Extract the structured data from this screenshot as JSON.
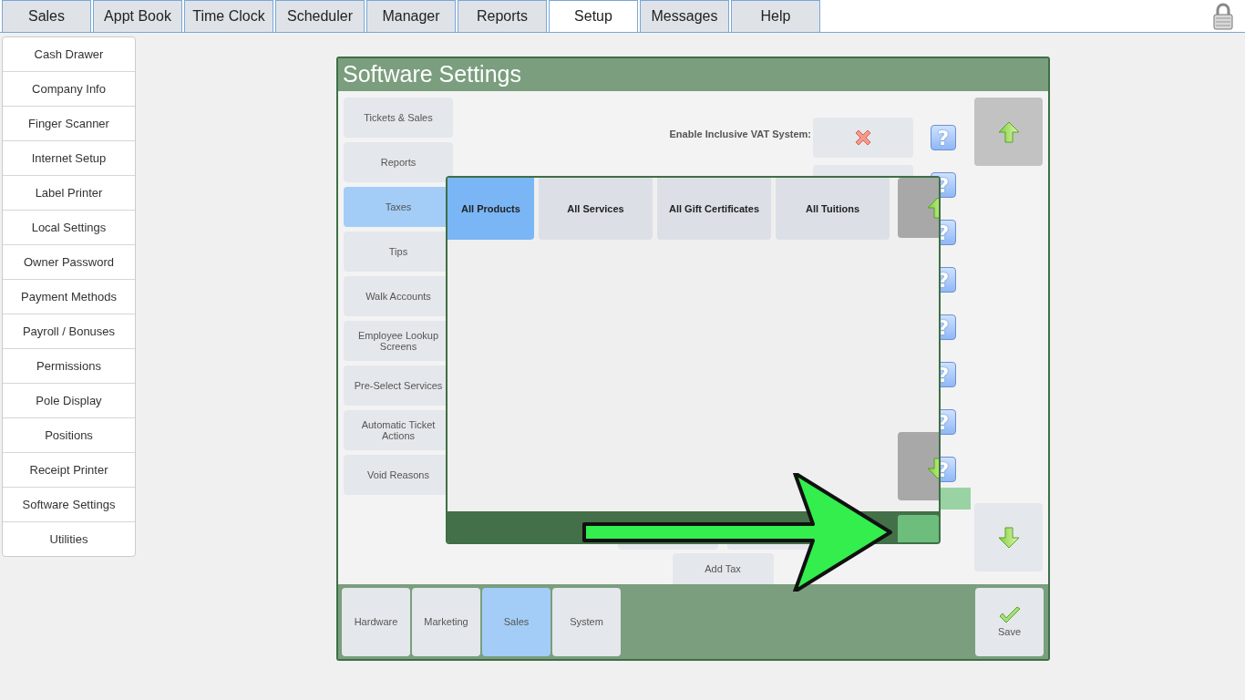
{
  "top_tabs": [
    {
      "label": "Sales",
      "selected": false
    },
    {
      "label": "Appt Book",
      "selected": false
    },
    {
      "label": "Time Clock",
      "selected": false
    },
    {
      "label": "Scheduler",
      "selected": false
    },
    {
      "label": "Manager",
      "selected": false
    },
    {
      "label": "Reports",
      "selected": false
    },
    {
      "label": "Setup",
      "selected": true
    },
    {
      "label": "Messages",
      "selected": false
    },
    {
      "label": "Help",
      "selected": false
    }
  ],
  "sidebar": {
    "items": [
      "Cash Drawer",
      "Company Info",
      "Finger Scanner",
      "Internet Setup",
      "Label Printer",
      "Local Settings",
      "Owner Password",
      "Payment Methods",
      "Payroll / Bonuses",
      "Permissions",
      "Pole Display",
      "Positions",
      "Receipt Printer",
      "Software Settings",
      "Utilities"
    ]
  },
  "panel": {
    "title": "Software Settings",
    "categories": [
      {
        "label": "Tickets & Sales",
        "selected": false
      },
      {
        "label": "Reports",
        "selected": false
      },
      {
        "label": "Taxes",
        "selected": true
      },
      {
        "label": "Tips",
        "selected": false
      },
      {
        "label": "Walk Accounts",
        "selected": false
      },
      {
        "label": "Employee Lookup Screens",
        "selected": false
      },
      {
        "label": "Pre-Select Services",
        "selected": false
      },
      {
        "label": "Automatic Ticket Actions",
        "selected": false
      },
      {
        "label": "Void Reasons",
        "selected": false
      }
    ],
    "settings_rows": [
      {
        "kind": "labeled",
        "label": "Enable Inclusive VAT System:",
        "enabled": false,
        "help": "?"
      },
      {
        "kind": "blank",
        "help": "?"
      },
      {
        "kind": "plain",
        "help": "?"
      },
      {
        "kind": "plain",
        "help": "?"
      },
      {
        "kind": "plain",
        "help": "?"
      },
      {
        "kind": "plain",
        "help": "?"
      },
      {
        "kind": "plain",
        "help": "?"
      },
      {
        "kind": "plain",
        "help": "?"
      }
    ],
    "add_tax_button": "Add Tax",
    "bottom_tabs": [
      {
        "label": "Hardware",
        "selected": false
      },
      {
        "label": "Marketing",
        "selected": false
      },
      {
        "label": "Sales",
        "selected": true
      },
      {
        "label": "System",
        "selected": false
      }
    ],
    "save_button": "Save"
  },
  "popup": {
    "tabs": [
      {
        "label": "All Products",
        "selected": true
      },
      {
        "label": "All Services",
        "selected": false
      },
      {
        "label": "All Gift Certificates",
        "selected": false
      },
      {
        "label": "All Tuitions",
        "selected": false
      }
    ]
  }
}
